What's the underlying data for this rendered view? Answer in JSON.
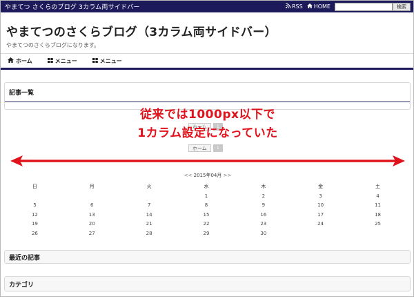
{
  "topbar": {
    "site_title": "やまてつ さくらのブログ 3カラム両サイドバー",
    "rss_label": "RSS",
    "home_label": "HOME",
    "search_placeholder": "",
    "search_button": "検索"
  },
  "header": {
    "title": "やまてつのさくらブログ（3カラム両サイドバー）",
    "description": "やまてつのさくらブログになります。"
  },
  "nav": {
    "items": [
      {
        "label": "ホーム",
        "icon": "home-icon"
      },
      {
        "label": "メニュー",
        "icon": "grid-icon"
      },
      {
        "label": "メニュー",
        "icon": "grid-icon"
      }
    ]
  },
  "main": {
    "article_list_title": "記事一覧",
    "pager_home": "ホーム",
    "pager_page": "1"
  },
  "annotation": {
    "line1": "従来では1000px以下で",
    "line2": "1カラム設定になっていた",
    "color": "#e0131c"
  },
  "calendar": {
    "prev": "<<",
    "month": "2015年04月",
    "next": ">>",
    "weekdays": [
      "日",
      "月",
      "火",
      "水",
      "木",
      "金",
      "土"
    ],
    "weeks": [
      [
        "",
        "",
        "",
        "1",
        "2",
        "3",
        "4"
      ],
      [
        "5",
        "6",
        "7",
        "8",
        "9",
        "10",
        "11"
      ],
      [
        "12",
        "13",
        "14",
        "15",
        "16",
        "17",
        "18"
      ],
      [
        "19",
        "20",
        "21",
        "22",
        "23",
        "24",
        "25"
      ],
      [
        "26",
        "27",
        "28",
        "29",
        "30",
        "",
        ""
      ]
    ]
  },
  "widgets": {
    "recent_posts": "最近の記事",
    "categories": "カテゴリ"
  },
  "colors": {
    "navy": "#1c1a5a",
    "arrow_red": "#e0131c"
  }
}
